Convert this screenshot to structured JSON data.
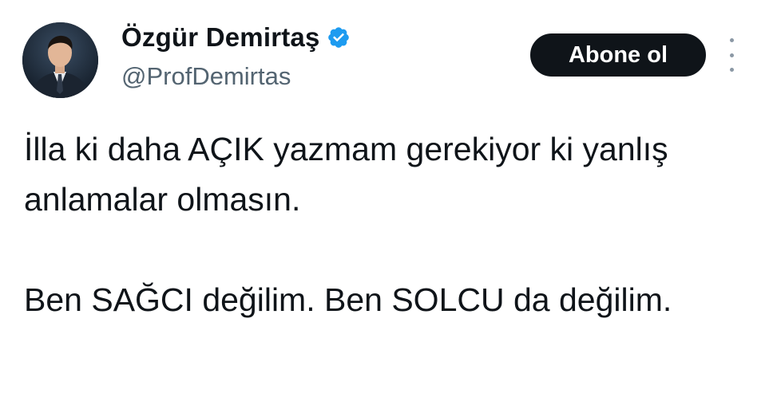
{
  "author": {
    "display_name": "Özgür Demirtaş",
    "handle": "@ProfDemirtas",
    "verified": true,
    "avatar_icon": "profile-photo"
  },
  "actions": {
    "follow_label": "Abone ol",
    "more_icon": "more-vertical-icon"
  },
  "tweet": {
    "paragraphs": [
      "İlla ki daha AÇIK yazmam gerekiyor ki yanlış anlamalar olmasın.",
      "Ben SAĞCI değilim. Ben SOLCU  da değilim."
    ]
  },
  "colors": {
    "text": "#0f1419",
    "secondary_text": "#536471",
    "verified": "#1d9bf0",
    "button_bg": "#0f1419",
    "button_text": "#ffffff"
  }
}
